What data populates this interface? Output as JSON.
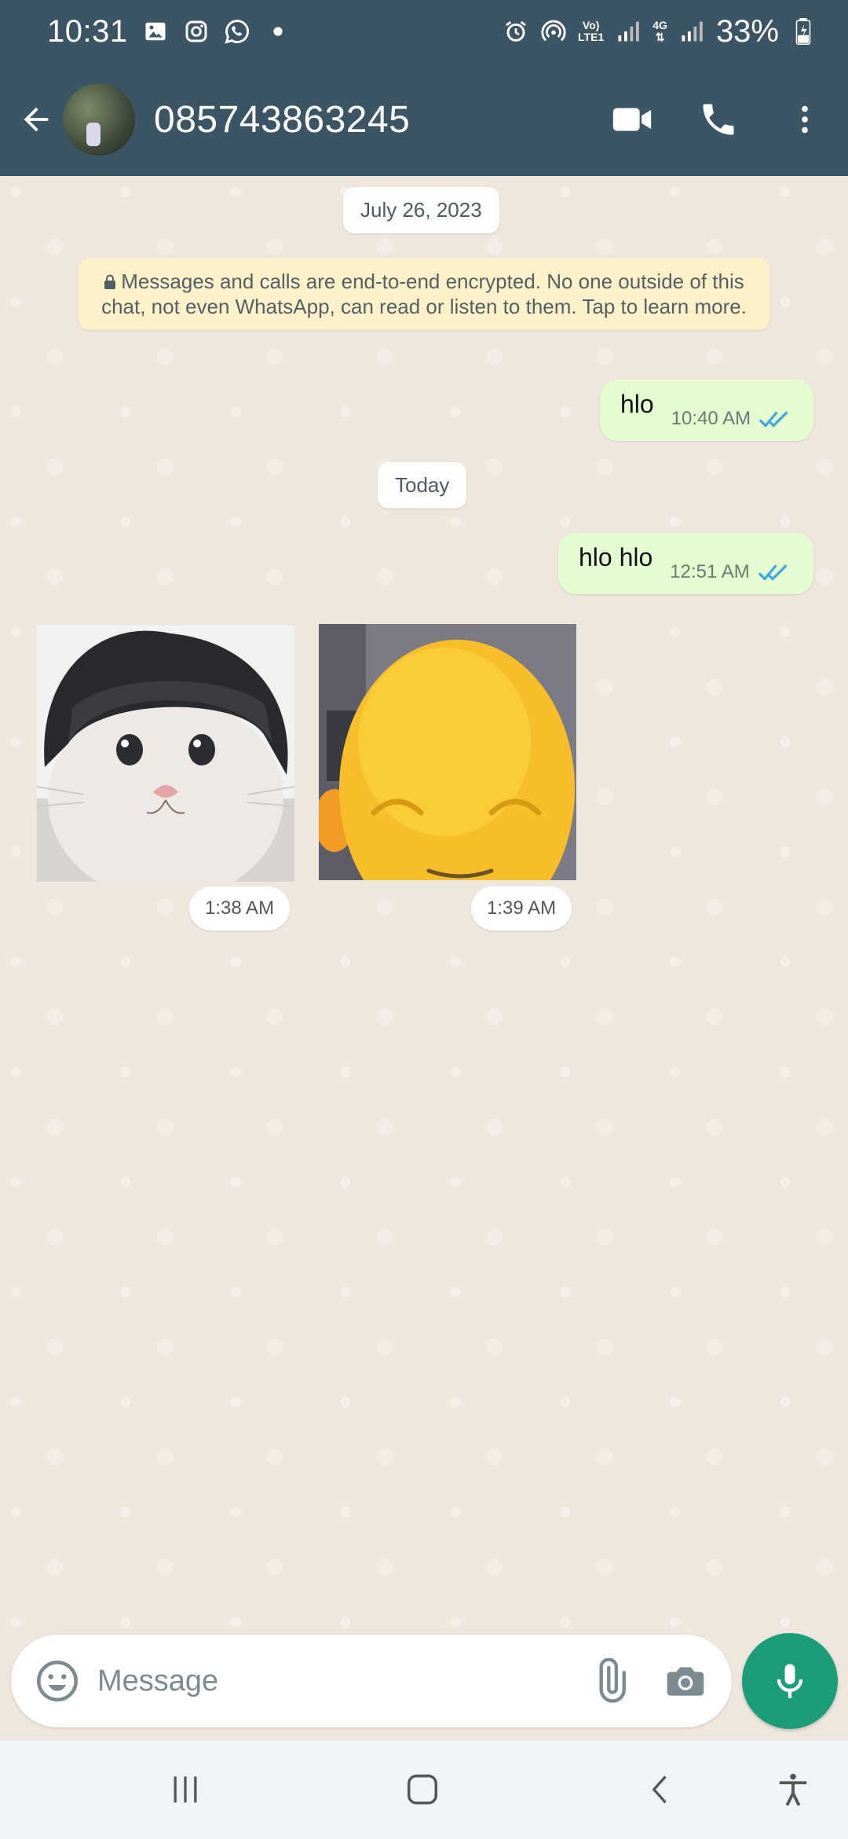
{
  "status_bar": {
    "time": "10:31",
    "network_label_top": "Vo)",
    "network_label_bottom": "LTE1",
    "network2_label": "4G",
    "battery": "33%"
  },
  "header": {
    "contact": "085743863245",
    "icons": [
      "back-arrow-icon",
      "video-call-icon",
      "voice-call-icon",
      "more-vert-icon"
    ]
  },
  "chat": {
    "date_1": "July 26, 2023",
    "encryption_notice": "Messages and calls are end-to-end encrypted. No one outside of this chat, not even WhatsApp, can read or listen to them. Tap to learn more.",
    "date_2": "Today",
    "messages": [
      {
        "direction": "out",
        "text": "hlo",
        "time": "10:40 AM",
        "status": "read"
      },
      {
        "direction": "out",
        "text": "hlo hlo",
        "time": "12:51 AM",
        "status": "read"
      },
      {
        "direction": "in",
        "type": "sticker",
        "subject": "crying cat with wig",
        "time": "1:38 AM"
      },
      {
        "direction": "in",
        "type": "sticker",
        "subject": "smiling yellow creature",
        "time": "1:39 AM"
      }
    ]
  },
  "compose": {
    "placeholder": "Message"
  },
  "colors": {
    "header_bg": "#3b5564",
    "chat_bg": "#efe7de",
    "outgoing_bubble": "#e5fcd1",
    "read_ticks": "#3fa6e0",
    "fab": "#1b9d7a"
  }
}
